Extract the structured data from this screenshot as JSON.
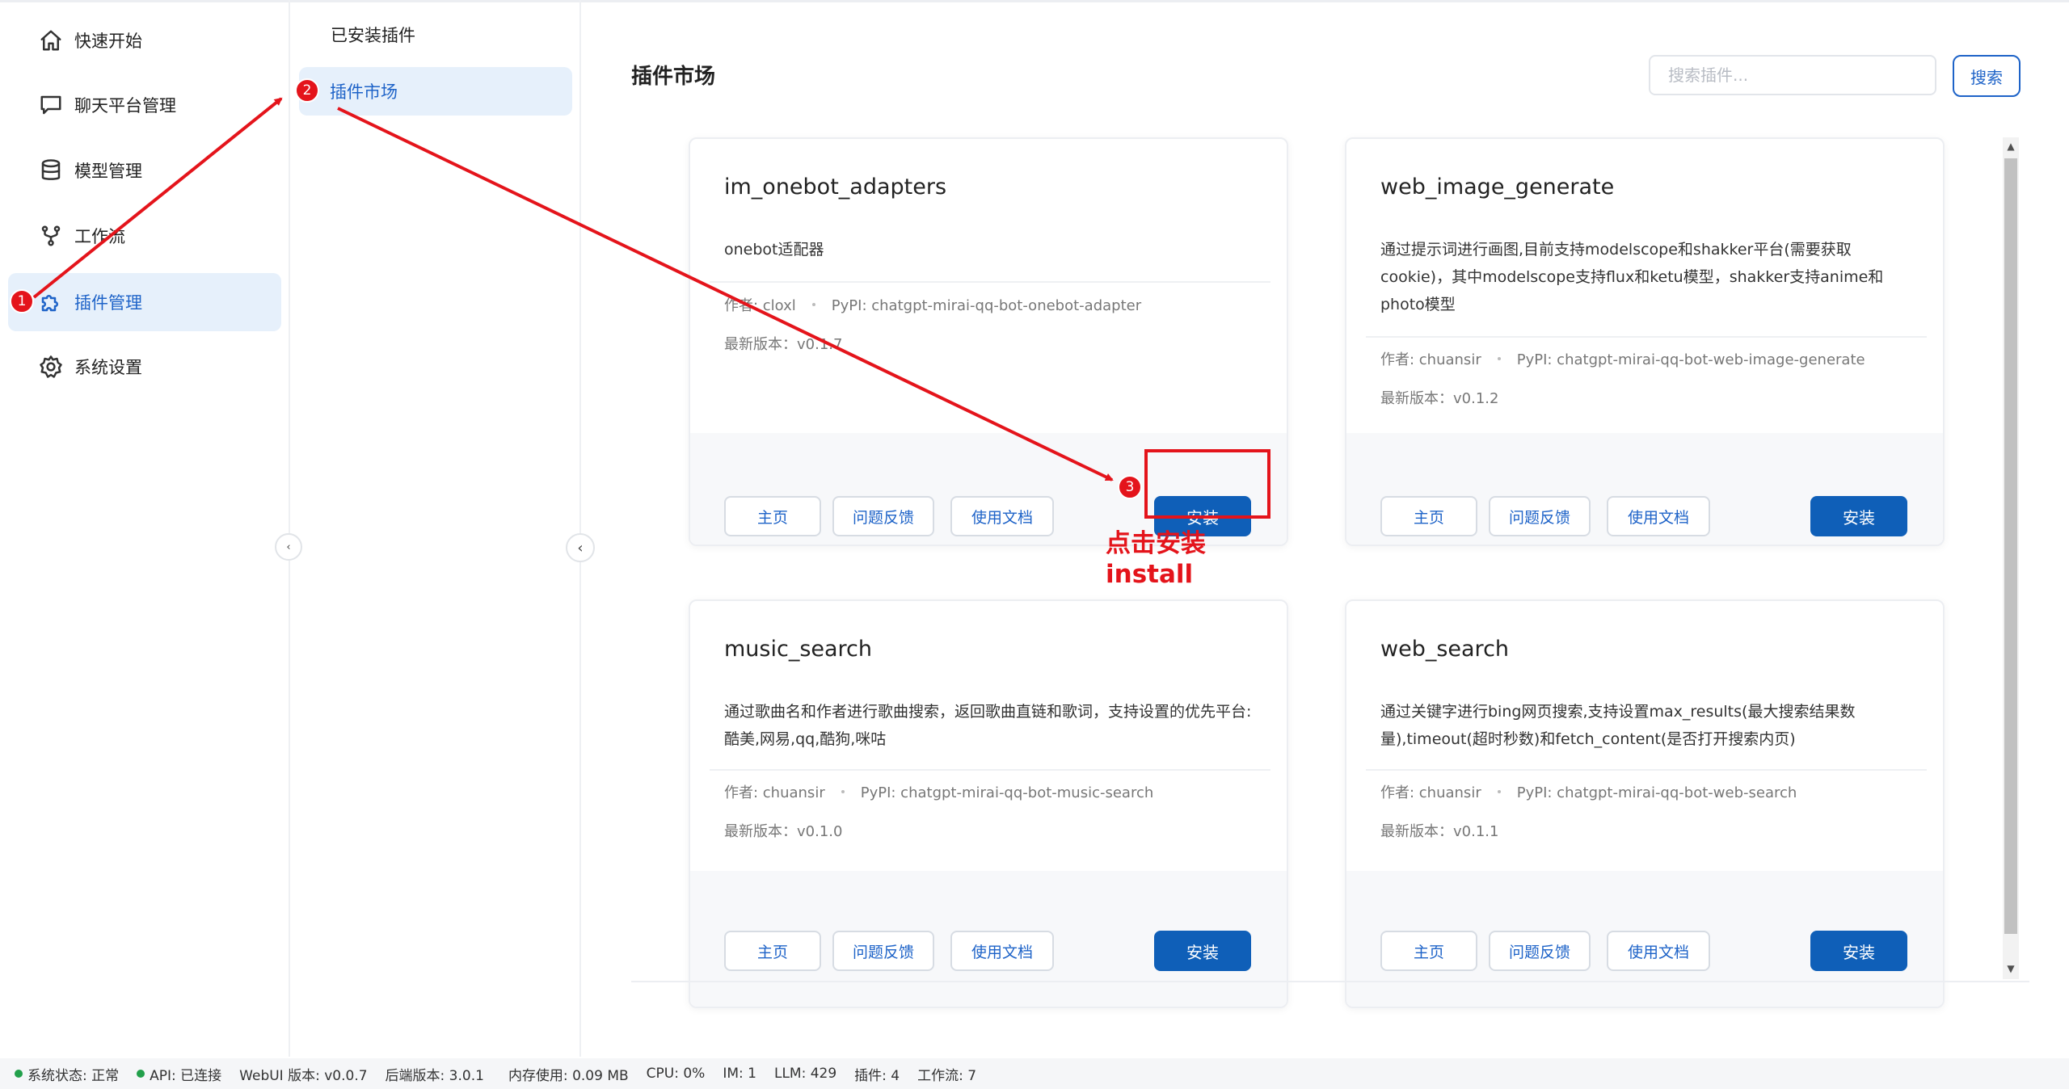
{
  "nav": {
    "items": [
      {
        "label": "快速开始",
        "icon": "home-icon"
      },
      {
        "label": "聊天平台管理",
        "icon": "chat-icon"
      },
      {
        "label": "模型管理",
        "icon": "database-icon"
      },
      {
        "label": "工作流",
        "icon": "workflow-icon"
      },
      {
        "label": "插件管理",
        "icon": "puzzle-icon",
        "active": true
      },
      {
        "label": "系统设置",
        "icon": "gear-icon"
      }
    ]
  },
  "subnav": {
    "installed_label": "已安装插件",
    "market_label": "插件市场"
  },
  "main": {
    "title": "插件市场",
    "search_placeholder": "搜索插件...",
    "search_button": "搜索"
  },
  "plugins": [
    {
      "name": "im_onebot_adapters",
      "desc": "onebot适配器",
      "author": "作者: cloxl",
      "pypi": "PyPI: chatgpt-mirai-qq-bot-onebot-adapter",
      "version": "最新版本：v0.1.7",
      "btn_home": "主页",
      "btn_issue": "问题反馈",
      "btn_docs": "使用文档",
      "btn_install": "安装"
    },
    {
      "name": "web_image_generate",
      "desc": "通过提示词进行画图,目前支持modelscope和shakker平台(需要获取cookie)，其中modelscope支持flux和ketu模型，shakker支持anime和photo模型",
      "author": "作者: chuansir",
      "pypi": "PyPI: chatgpt-mirai-qq-bot-web-image-generate",
      "version": "最新版本：v0.1.2",
      "btn_home": "主页",
      "btn_issue": "问题反馈",
      "btn_docs": "使用文档",
      "btn_install": "安装"
    },
    {
      "name": "music_search",
      "desc": "通过歌曲名和作者进行歌曲搜索，返回歌曲直链和歌词，支持设置的优先平台:酷美,网易,qq,酷狗,咪咕",
      "author": "作者: chuansir",
      "pypi": "PyPI: chatgpt-mirai-qq-bot-music-search",
      "version": "最新版本：v0.1.0",
      "btn_home": "主页",
      "btn_issue": "问题反馈",
      "btn_docs": "使用文档",
      "btn_install": "安装"
    },
    {
      "name": "web_search",
      "desc": "通过关键字进行bing网页搜索,支持设置max_results(最大搜索结果数量),timeout(超时秒数)和fetch_content(是否打开搜索内页)",
      "author": "作者: chuansir",
      "pypi": "PyPI: chatgpt-mirai-qq-bot-web-search",
      "version": "最新版本：v0.1.1",
      "btn_home": "主页",
      "btn_issue": "问题反馈",
      "btn_docs": "使用文档",
      "btn_install": "安装"
    }
  ],
  "status": {
    "system": "系统状态: 正常",
    "api": "API: 已连接",
    "webui": "WebUI 版本: v0.0.7",
    "backend": "后端版本: 3.0.1",
    "memory": "内存使用: 0.09 MB",
    "cpu": "CPU: 0%",
    "im": "IM: 1",
    "llm": "LLM: 429",
    "plugins": "插件: 4",
    "workflows": "工作流: 7",
    "ok_color": "#22a04b"
  },
  "annotations": {
    "step1": "1",
    "step2": "2",
    "step3": "3",
    "hint": "点击安装\ninstall",
    "color": "#e4141b"
  }
}
